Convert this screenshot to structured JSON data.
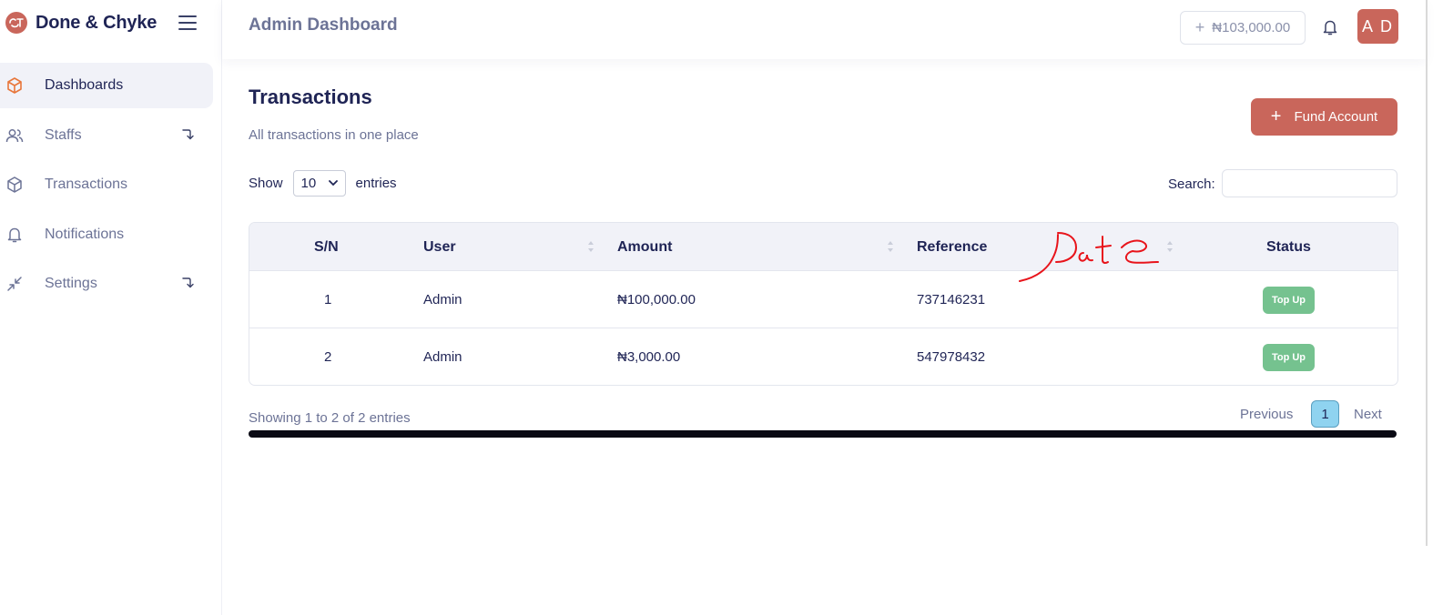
{
  "brand": {
    "name": "Done & Chyke",
    "logo_icon": "brand-logo-icon"
  },
  "sidebar": {
    "items": [
      {
        "label": "Dashboards",
        "icon": "cube-icon",
        "active": true,
        "has_submenu": false
      },
      {
        "label": "Staffs",
        "icon": "users-icon",
        "active": false,
        "has_submenu": true
      },
      {
        "label": "Transactions",
        "icon": "cube-icon",
        "active": false,
        "has_submenu": false
      },
      {
        "label": "Notifications",
        "icon": "bell-icon",
        "active": false,
        "has_submenu": false
      },
      {
        "label": "Settings",
        "icon": "collapse-arrows-icon",
        "active": false,
        "has_submenu": true
      }
    ]
  },
  "header": {
    "title": "Admin Dashboard",
    "balance": "₦103,000.00",
    "avatar_initials": "A D"
  },
  "main": {
    "title": "Transactions",
    "subtitle": "All transactions in one place",
    "fund_button": "Fund Account"
  },
  "table_controls": {
    "show_label": "Show",
    "entries_value": "10",
    "entries_label": "entries",
    "search_label": "Search:",
    "search_value": ""
  },
  "table": {
    "columns": [
      "S/N",
      "User",
      "Amount",
      "Reference",
      "Status"
    ],
    "rows": [
      {
        "sn": "1",
        "user": "Admin",
        "amount": "₦100,000.00",
        "reference": "737146231",
        "status": "Top Up"
      },
      {
        "sn": "2",
        "user": "Admin",
        "amount": "₦3,000.00",
        "reference": "547978432",
        "status": "Top Up"
      }
    ]
  },
  "pagination": {
    "info": "Showing 1 to 2 of 2 entries",
    "previous": "Previous",
    "current_page": "1",
    "next": "Next"
  },
  "annotation": {
    "text": "Date",
    "color": "#e8141b"
  },
  "colors": {
    "accent": "#c9665b",
    "status_green": "#75c28f",
    "navy": "#1f2455",
    "page_active": "#8fd3f0"
  }
}
